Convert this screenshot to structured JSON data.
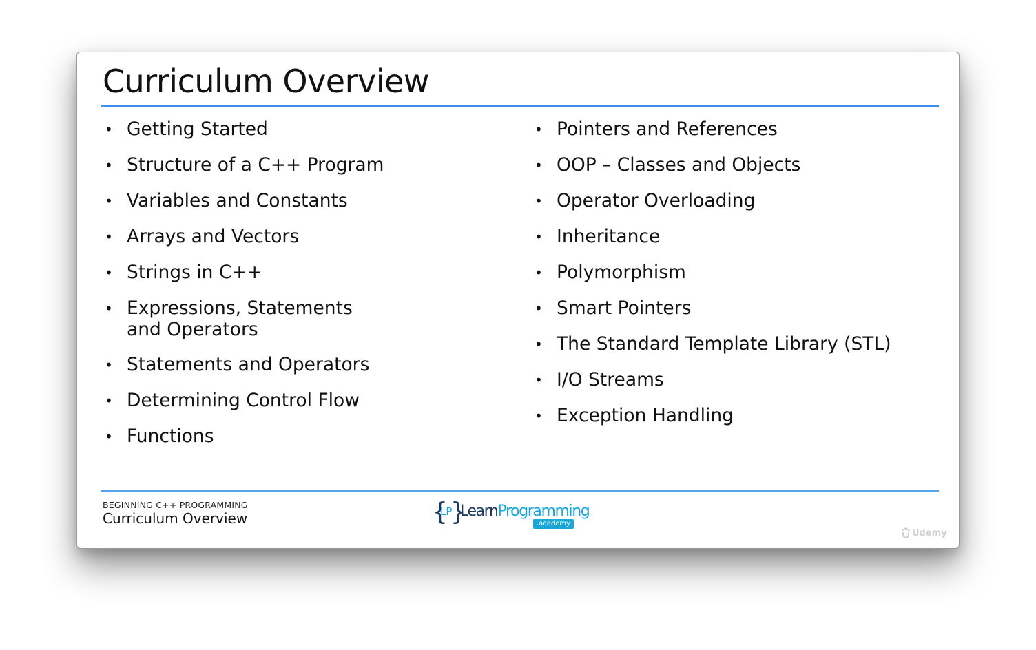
{
  "slide": {
    "title": "Curriculum Overview",
    "left_items": [
      "Getting Started",
      "Structure of a C++ Program",
      "Variables and Constants",
      "Arrays and Vectors",
      "Strings in C++",
      "Expressions, Statements\nand Operators",
      "Statements and Operators",
      "Determining Control Flow",
      "Functions"
    ],
    "right_items": [
      "Pointers and References",
      "OOP – Classes and Objects",
      "Operator Overloading",
      "Inheritance",
      "Polymorphism",
      "Smart Pointers",
      "The Standard Template Library (STL)",
      "I/O Streams",
      "Exception Handling"
    ],
    "bullet": "•"
  },
  "footer": {
    "course": "BEGINNING C++ PROGRAMMING",
    "section": "Curriculum Overview"
  },
  "logo": {
    "brace_open": "{",
    "brace_close": "}",
    "monogram": "LP",
    "word_part1": "Learn",
    "word_part2": "Programming",
    "sub": ".academy"
  },
  "watermark": {
    "icon": "udemy-icon",
    "text": "Udemy"
  },
  "colors": {
    "accent_blue": "#3d8ee6",
    "logo_cyan": "#1aa7d8",
    "logo_navy": "#1f3b5c",
    "text": "#111111"
  }
}
